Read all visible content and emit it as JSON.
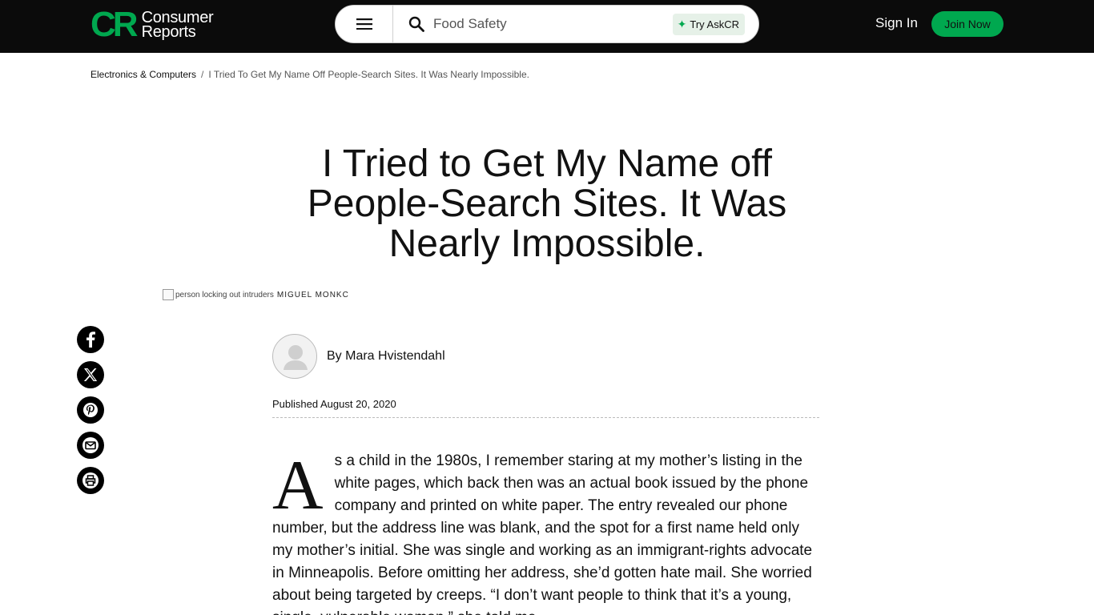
{
  "header": {
    "logo_mark": "CR",
    "logo_line1": "Consumer",
    "logo_line2": "Reports",
    "search_placeholder": "Food Safety",
    "askcr_label": "Try AskCR",
    "signin_label": "Sign In",
    "join_label": "Join Now"
  },
  "breadcrumb": {
    "parent": "Electronics & Computers",
    "separator": "/",
    "current": "I Tried To Get My Name Off People-Search Sites. It Was Nearly Impossible."
  },
  "article": {
    "title": "I Tried to Get My Name off People-Search Sites. It Was Nearly Impossible.",
    "image_alt": "person locking out intruders",
    "image_credit": "MIGUEL MONKC",
    "byline_prefix": "By ",
    "author": "Mara Hvistendahl",
    "published": "Published August 20, 2020",
    "dropcap": "A",
    "body": "s a child in the 1980s, I remember staring at my mother’s listing in the white pages, which back then was an actual book issued by the phone company and printed on white paper. The entry revealed our phone number, but the address line was blank, and the spot for a first name held only my mother’s initial. She was single and working as an immigrant-rights advocate in Minneapolis. Before omitting her address, she’d gotten hate mail. She worried about being targeted by creeps. “I don’t want people to think that it’s a young, single, vulnerable woman,” she told me."
  },
  "social": {
    "icons": [
      "facebook-icon",
      "x-icon",
      "pinterest-icon",
      "email-icon",
      "print-icon"
    ]
  },
  "colors": {
    "header_bg": "#0b0b0b",
    "brand_green": "#00a84f",
    "askcr_bg": "#e6f1e8"
  }
}
